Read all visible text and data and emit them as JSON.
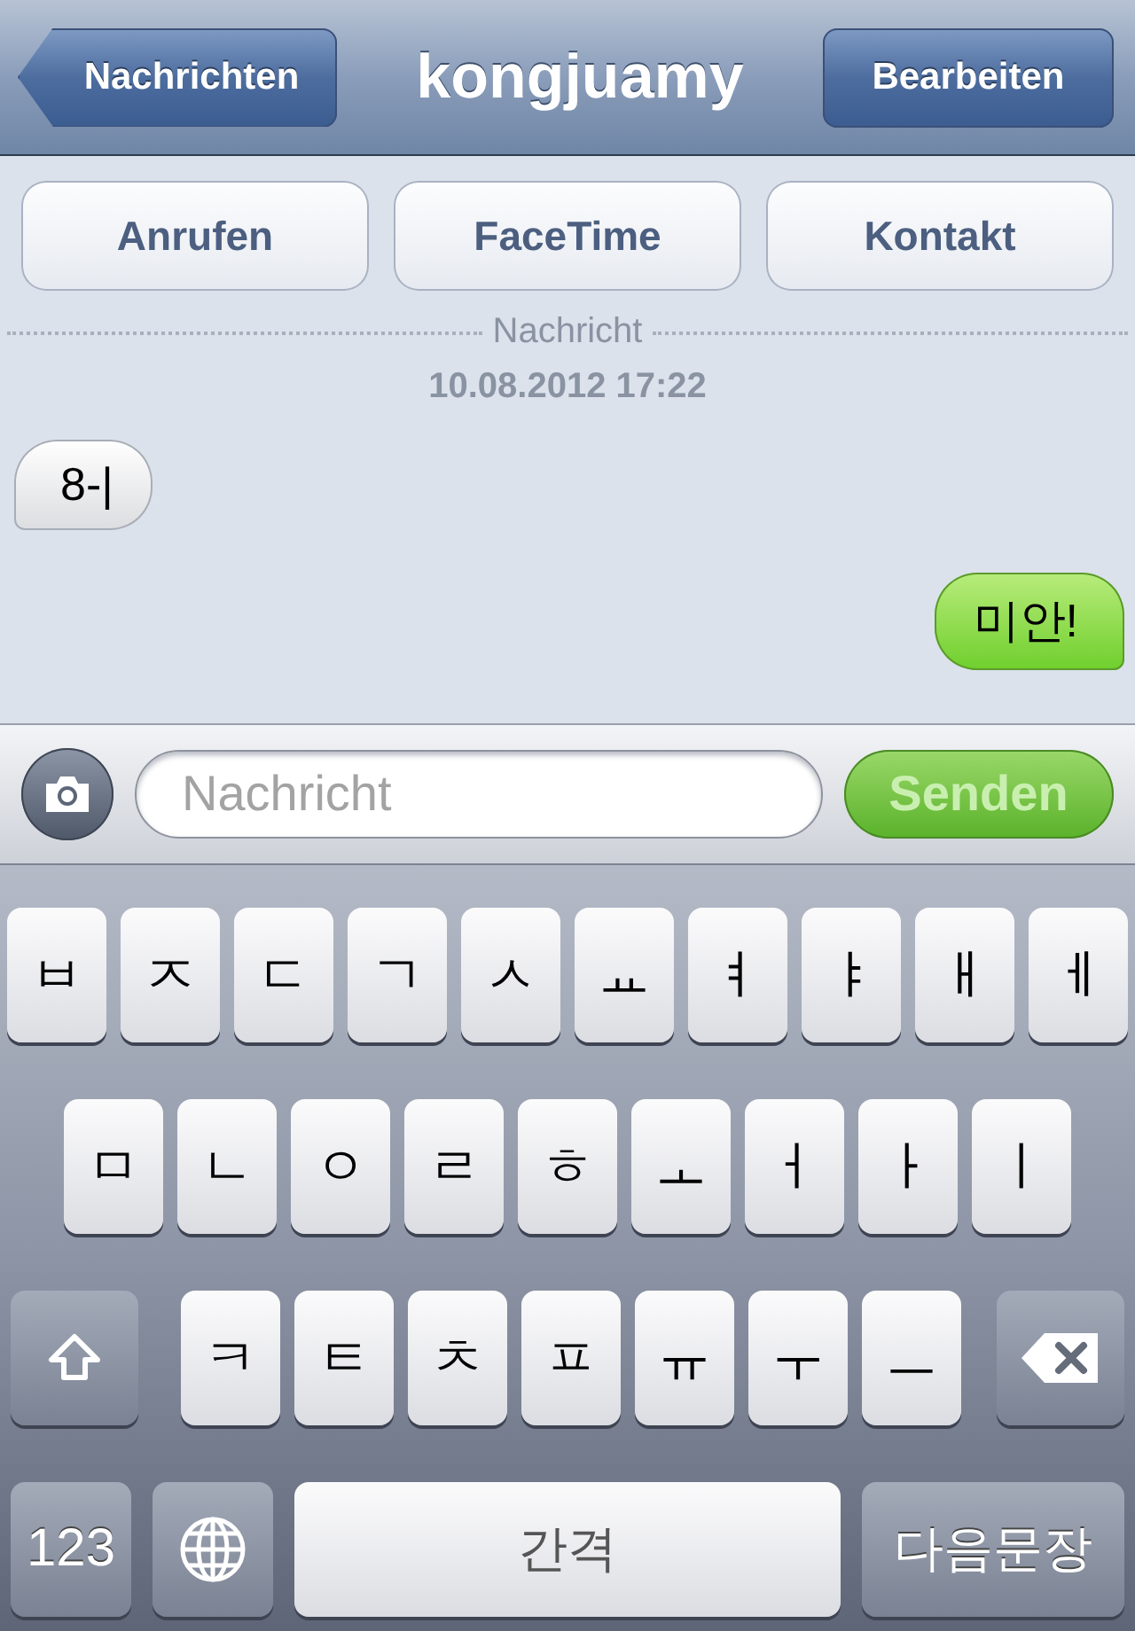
{
  "nav": {
    "back": "Nachrichten",
    "title": "kongjuamy",
    "edit": "Bearbeiten"
  },
  "actions": [
    "Anrufen",
    "FaceTime",
    "Kontakt"
  ],
  "thread": {
    "label": "Nachricht",
    "timestamp": "10.08.2012 17:22"
  },
  "messages": [
    {
      "text": "8-|",
      "kind": "received"
    },
    {
      "text": "미안!",
      "kind": "sent"
    }
  ],
  "composer": {
    "placeholder": "Nachricht",
    "send": "Senden"
  },
  "keyboard": [
    [
      {
        "kind": "letter",
        "label": "ㅂ"
      },
      {
        "kind": "letter",
        "label": "ㅈ"
      },
      {
        "kind": "letter",
        "label": "ㄷ"
      },
      {
        "kind": "letter",
        "label": "ㄱ"
      },
      {
        "kind": "letter",
        "label": "ㅅ"
      },
      {
        "kind": "letter",
        "label": "ㅛ"
      },
      {
        "kind": "letter",
        "label": "ㅕ"
      },
      {
        "kind": "letter",
        "label": "ㅑ"
      },
      {
        "kind": "letter",
        "label": "ㅐ"
      },
      {
        "kind": "letter",
        "label": "ㅔ"
      }
    ],
    [
      {
        "kind": "letter",
        "label": "ㅁ"
      },
      {
        "kind": "letter",
        "label": "ㄴ"
      },
      {
        "kind": "letter",
        "label": "ㅇ"
      },
      {
        "kind": "letter",
        "label": "ㄹ"
      },
      {
        "kind": "letter",
        "label": "ㅎ"
      },
      {
        "kind": "letter",
        "label": "ㅗ"
      },
      {
        "kind": "letter",
        "label": "ㅓ"
      },
      {
        "kind": "letter",
        "label": "ㅏ"
      },
      {
        "kind": "letter",
        "label": "ㅣ"
      }
    ],
    [
      {
        "kind": "shift"
      },
      {
        "kind": "letter",
        "label": "ㅋ"
      },
      {
        "kind": "letter",
        "label": "ㅌ"
      },
      {
        "kind": "letter",
        "label": "ㅊ"
      },
      {
        "kind": "letter",
        "label": "ㅍ"
      },
      {
        "kind": "letter",
        "label": "ㅠ"
      },
      {
        "kind": "letter",
        "label": "ㅜ"
      },
      {
        "kind": "letter",
        "label": "ㅡ"
      },
      {
        "kind": "delete"
      }
    ],
    [
      {
        "kind": "numbers",
        "label": "123"
      },
      {
        "kind": "globe"
      },
      {
        "kind": "space",
        "label": "간격"
      },
      {
        "kind": "return",
        "label": "다음문장"
      }
    ]
  ]
}
